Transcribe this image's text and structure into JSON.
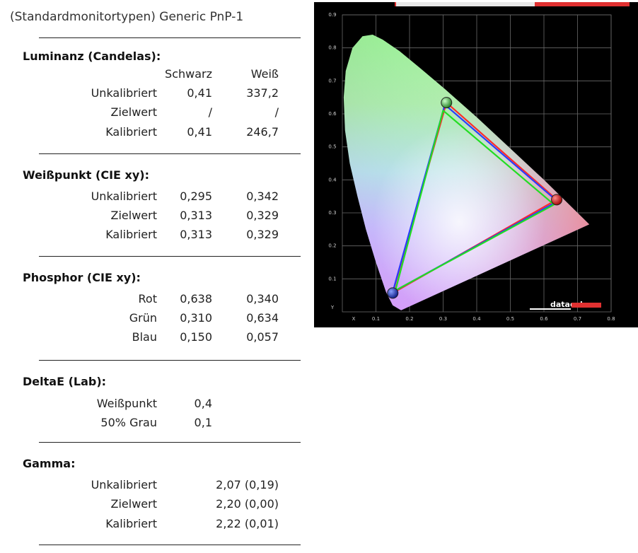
{
  "header": {
    "title": "(Standardmonitortypen) Generic PnP-1"
  },
  "luminance": {
    "title": "Luminanz (Candelas):",
    "col_black": "Schwarz",
    "col_white": "Weiß",
    "rows": [
      {
        "label": "Unkalibriert",
        "black": "0,41",
        "white": "337,2"
      },
      {
        "label": "Zielwert",
        "black": "/",
        "white": "/"
      },
      {
        "label": "Kalibriert",
        "black": "0,41",
        "white": "246,7"
      }
    ]
  },
  "whitepoint": {
    "title": "Weißpunkt (CIE xy):",
    "rows": [
      {
        "label": "Unkalibriert",
        "x": "0,295",
        "y": "0,342"
      },
      {
        "label": "Zielwert",
        "x": "0,313",
        "y": "0,329"
      },
      {
        "label": "Kalibriert",
        "x": "0,313",
        "y": "0,329"
      }
    ]
  },
  "phosphor": {
    "title": "Phosphor (CIE xy):",
    "rows": [
      {
        "label": "Rot",
        "x": "0,638",
        "y": "0,340"
      },
      {
        "label": "Grün",
        "x": "0,310",
        "y": "0,634"
      },
      {
        "label": "Blau",
        "x": "0,150",
        "y": "0,057"
      }
    ]
  },
  "deltae": {
    "title": "DeltaE (Lab):",
    "rows": [
      {
        "label": "Weißpunkt",
        "value": "0,4"
      },
      {
        "label": "50% Grau",
        "value": "0,1"
      }
    ]
  },
  "gamma": {
    "title": "Gamma:",
    "rows": [
      {
        "label": "Unkalibriert",
        "value": "2,07 (0,19)"
      },
      {
        "label": "Zielwert",
        "value": "2,20 (0,00)"
      },
      {
        "label": "Kalibriert",
        "value": "2,22 (0,01)"
      }
    ]
  },
  "chart_data": {
    "type": "scatter",
    "xlabel": "X",
    "ylabel": "Y",
    "xlim": [
      0,
      0.8
    ],
    "ylim": [
      0,
      0.9
    ],
    "x_ticks": [
      "0.1",
      "0.2",
      "0.3",
      "0.4",
      "0.5",
      "0.6",
      "0.7",
      "0.8"
    ],
    "y_ticks": [
      "0.1",
      "0.2",
      "0.3",
      "0.4",
      "0.5",
      "0.6",
      "0.7",
      "0.8",
      "0.9"
    ],
    "grid": true,
    "logo": "datacolor",
    "gamuts": [
      {
        "color": "#ff2a2a",
        "points": [
          [
            0.638,
            0.34
          ],
          [
            0.31,
            0.634
          ],
          [
            0.15,
            0.057
          ]
        ]
      },
      {
        "color": "#2a3cff",
        "points": [
          [
            0.64,
            0.335
          ],
          [
            0.305,
            0.628
          ],
          [
            0.15,
            0.06
          ]
        ]
      },
      {
        "color": "#22dd22",
        "points": [
          [
            0.63,
            0.325
          ],
          [
            0.3,
            0.61
          ],
          [
            0.158,
            0.065
          ]
        ]
      }
    ],
    "primaries": [
      {
        "color": "#d42020",
        "x": 0.638,
        "y": 0.34
      },
      {
        "color": "#3aa83a",
        "x": 0.31,
        "y": 0.634
      },
      {
        "color": "#2030c0",
        "x": 0.15,
        "y": 0.057
      }
    ],
    "locus": [
      [
        0.175,
        0.005
      ],
      [
        0.15,
        0.02
      ],
      [
        0.13,
        0.06
      ],
      [
        0.1,
        0.15
      ],
      [
        0.07,
        0.25
      ],
      [
        0.045,
        0.35
      ],
      [
        0.022,
        0.45
      ],
      [
        0.008,
        0.55
      ],
      [
        0.004,
        0.65
      ],
      [
        0.01,
        0.73
      ],
      [
        0.03,
        0.8
      ],
      [
        0.06,
        0.835
      ],
      [
        0.09,
        0.84
      ],
      [
        0.12,
        0.825
      ],
      [
        0.17,
        0.79
      ],
      [
        0.23,
        0.74
      ],
      [
        0.3,
        0.68
      ],
      [
        0.4,
        0.59
      ],
      [
        0.5,
        0.495
      ],
      [
        0.6,
        0.4
      ],
      [
        0.67,
        0.33
      ],
      [
        0.735,
        0.265
      ]
    ]
  }
}
